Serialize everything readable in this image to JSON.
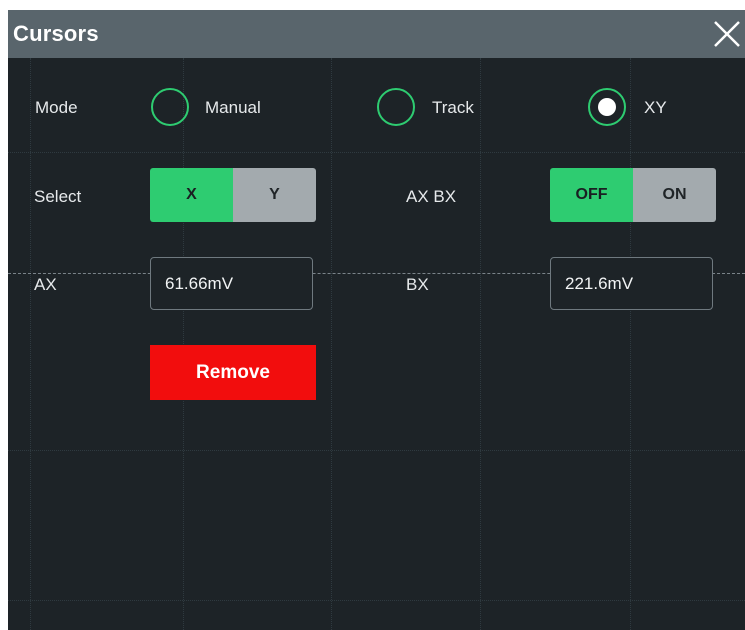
{
  "dialog": {
    "title": "Cursors",
    "close_icon": "close-icon"
  },
  "mode": {
    "label": "Mode",
    "options": [
      {
        "label": "Manual",
        "selected": false
      },
      {
        "label": "Track",
        "selected": false
      },
      {
        "label": "XY",
        "selected": true
      }
    ]
  },
  "select": {
    "label": "Select",
    "options": [
      "X",
      "Y"
    ],
    "active": "X"
  },
  "axbx": {
    "label": "AX BX",
    "options": [
      "OFF",
      "ON"
    ],
    "active": "OFF"
  },
  "ax": {
    "label": "AX",
    "value": "61.66mV"
  },
  "bx": {
    "label": "BX",
    "value": "221.6mV"
  },
  "remove": {
    "label": "Remove"
  },
  "colors": {
    "accent": "#2ecc71",
    "remove": "#f20d0d",
    "titlebar": "#59656c",
    "background": "#1d2327"
  }
}
